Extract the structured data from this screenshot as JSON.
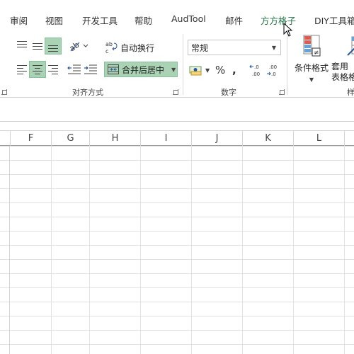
{
  "menu": {
    "tabs": [
      "审阅",
      "视图",
      "开发工具",
      "帮助",
      "AudTool",
      "邮件",
      "方方格子",
      "DIY工具箱"
    ],
    "active_tab": "方方格子"
  },
  "alignment": {
    "wrap_text_label": "自动换行",
    "wrap_text_glyph": "ab c",
    "merge_center_label": "合并后居中",
    "group_label": "对齐方式"
  },
  "number": {
    "format_value": "常规",
    "percent_label": "%",
    "comma_label": ",",
    "increase_decimal": "←0\n.00",
    "decrease_decimal": ".00\n→.0",
    "group_label": "数字"
  },
  "styles": {
    "conditional_format_label": "条件格式",
    "table_format_label": "套用\n表格格",
    "group_label_partial": "样"
  },
  "grid": {
    "columns": [
      "F",
      "G",
      "H",
      "I",
      "J",
      "K",
      "L"
    ]
  },
  "colors": {
    "accent": "#217346",
    "selected_button": "#a9d3b4"
  }
}
